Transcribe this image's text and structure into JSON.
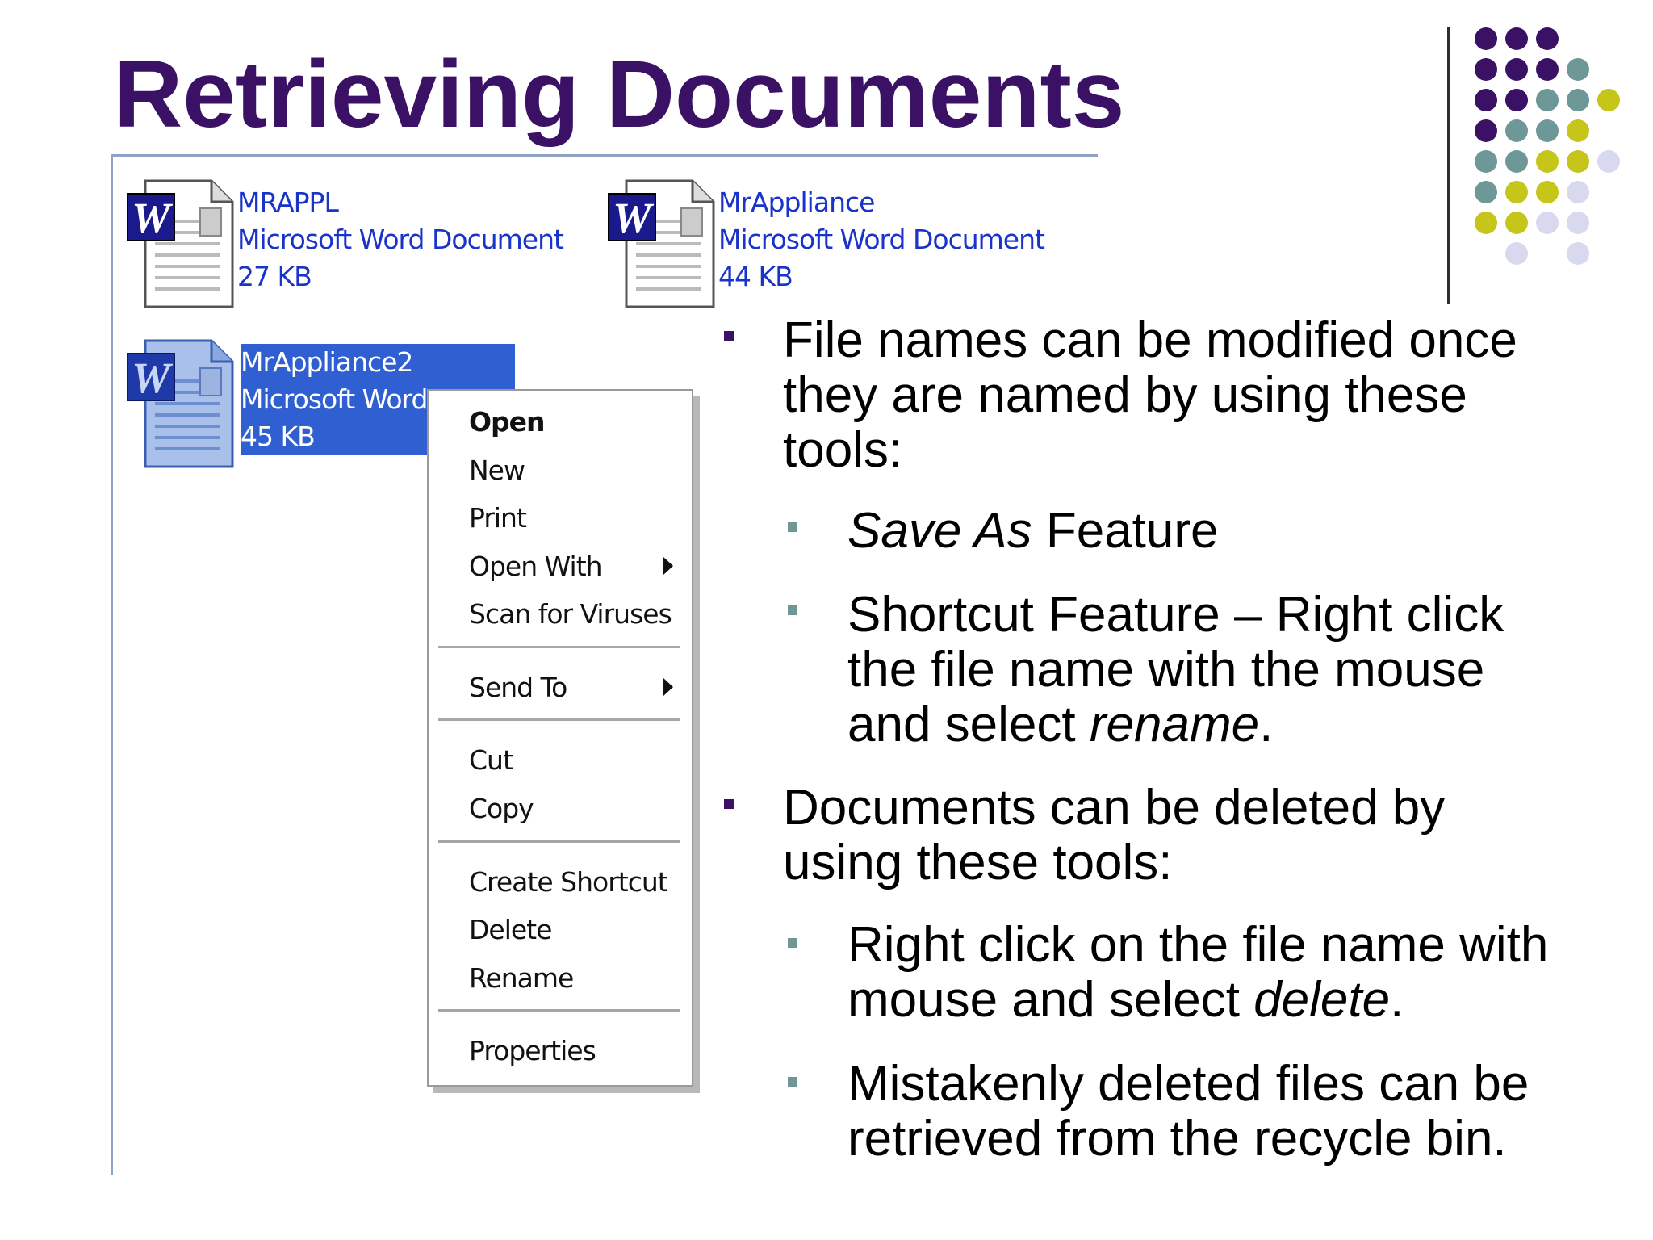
{
  "slide": {
    "title": "Retrieving Documents",
    "colors": {
      "title": "#3b1166",
      "purple": "#3b1166",
      "teal": "#6e9898",
      "olive": "#c5c51a",
      "lavender": "#d8d8ee",
      "selection": "#2f5fd0",
      "file_text": "#1a33c8"
    }
  },
  "files": [
    {
      "name": "MRAPPL",
      "type": "Microsoft Word Document",
      "size": "27 KB",
      "icon": "word-document-icon",
      "selected": false
    },
    {
      "name": "MrAppliance",
      "type": "Microsoft Word Document",
      "size": "44 KB",
      "icon": "word-document-icon",
      "selected": false
    },
    {
      "name": "MrAppliance2",
      "type": "Microsoft Word Do",
      "size": "45 KB",
      "icon": "word-document-icon",
      "selected": true
    }
  ],
  "context_menu": {
    "items": [
      {
        "label": "Open",
        "bold": true
      },
      {
        "label": "New"
      },
      {
        "label": "Print"
      },
      {
        "label": "Open With",
        "submenu": true
      },
      {
        "label": "Scan for Viruses"
      },
      {
        "label": "Send To",
        "submenu": true
      },
      {
        "label": "Cut"
      },
      {
        "label": "Copy"
      },
      {
        "label": "Create Shortcut"
      },
      {
        "label": "Delete"
      },
      {
        "label": "Rename"
      },
      {
        "label": "Properties"
      }
    ],
    "submenu_icon": "triangle-right-icon"
  },
  "bullets": [
    {
      "level": 1,
      "text": "File names can be modified once they are named by using these tools:"
    },
    {
      "level": 2,
      "italic": "Save As",
      "text": " Feature"
    },
    {
      "level": 2,
      "text": "Shortcut Feature – Right click the file name with the mouse and select ",
      "italic": "rename",
      "tail": "."
    },
    {
      "level": 1,
      "text": "Documents can be deleted by using these tools:"
    },
    {
      "level": 2,
      "text": "Right click on the file name with mouse and select ",
      "italic": "delete",
      "tail": "."
    },
    {
      "level": 2,
      "text": "Mistakenly deleted files can be retrieved from the recycle bin."
    }
  ]
}
